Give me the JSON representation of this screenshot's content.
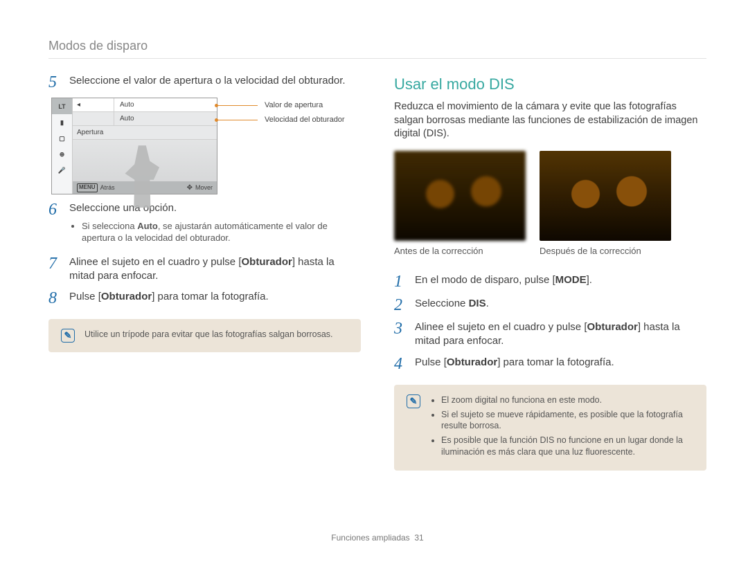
{
  "breadcrumb": "Modos de disparo",
  "left": {
    "step5": {
      "num": "5",
      "text_a": "Seleccione el valor de apertura o la velocidad del obturador."
    },
    "lcd": {
      "tag": "LT",
      "row1_val": "Auto",
      "row2_val": "Auto",
      "row3": "Apertura",
      "foot_back": "Atrás",
      "foot_move": "Mover",
      "callout1": "Valor de apertura",
      "callout2": "Velocidad del obturador"
    },
    "step6": {
      "num": "6",
      "text": "Seleccione una opción.",
      "bullet_a": "Si selecciona ",
      "bullet_b": "Auto",
      "bullet_c": ", se ajustarán automáticamente el valor de apertura o la velocidad del obturador."
    },
    "step7": {
      "num": "7",
      "text_a": "Alinee el sujeto en el cuadro y pulse [",
      "text_b": "Obturador",
      "text_c": "] hasta la mitad para enfocar."
    },
    "step8": {
      "num": "8",
      "text_a": "Pulse [",
      "text_b": "Obturador",
      "text_c": "] para tomar la fotografía."
    },
    "note": "Utilice un trípode para evitar que las fotografías salgan borrosas."
  },
  "right": {
    "heading": "Usar el modo DIS",
    "intro": "Reduzca el movimiento de la cámara y evite que las fotografías salgan borrosas mediante las funciones de estabilización de imagen digital (DIS).",
    "before_cap": "Antes de la corrección",
    "after_cap": "Después de la corrección",
    "step1": {
      "num": "1",
      "text_a": "En el modo de disparo, pulse [",
      "text_b": "MODE",
      "text_c": "]."
    },
    "step2": {
      "num": "2",
      "text_a": "Seleccione ",
      "text_b": "DIS",
      "text_c": "."
    },
    "step3": {
      "num": "3",
      "text_a": "Alinee el sujeto en el cuadro y pulse [",
      "text_b": "Obturador",
      "text_c": "] hasta la mitad para enfocar."
    },
    "step4": {
      "num": "4",
      "text_a": "Pulse [",
      "text_b": "Obturador",
      "text_c": "] para tomar la fotografía."
    },
    "notes": {
      "n1": "El zoom digital no funciona en este modo.",
      "n2": "Si el sujeto se mueve rápidamente, es posible que la fotografía resulte borrosa.",
      "n3": "Es posible que la función DIS no funcione en un lugar donde la iluminación es más clara que una luz fluorescente."
    }
  },
  "footer": {
    "section": "Funciones ampliadas",
    "page": "31"
  }
}
